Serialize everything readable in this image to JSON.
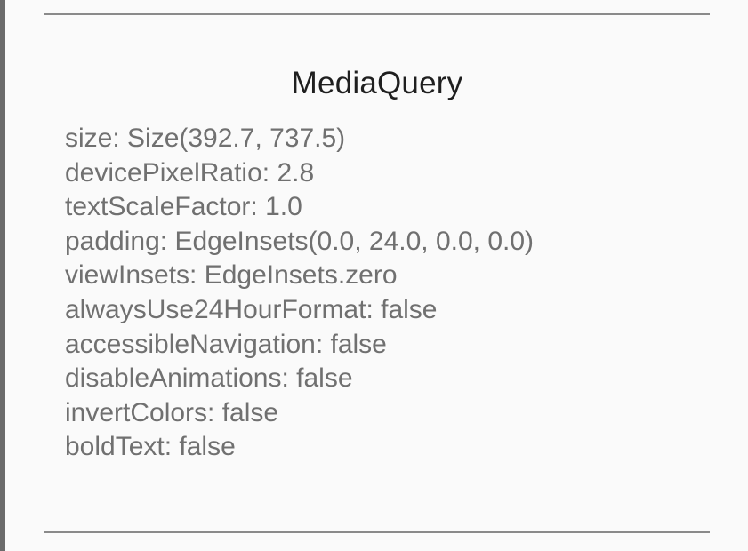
{
  "card": {
    "title": "MediaQuery",
    "properties": [
      "size: Size(392.7, 737.5)",
      "devicePixelRatio: 2.8",
      "textScaleFactor: 1.0",
      "padding: EdgeInsets(0.0, 24.0, 0.0, 0.0)",
      "viewInsets: EdgeInsets.zero",
      "alwaysUse24HourFormat: false",
      "accessibleNavigation: false",
      "disableAnimations: false",
      "invertColors: false",
      "boldText: false"
    ]
  },
  "colors": {
    "background": "#fafafa",
    "title": "#1f1f1f",
    "text": "#707070",
    "divider": "#8a8a8a",
    "left_edge": "#6b6b6b"
  }
}
